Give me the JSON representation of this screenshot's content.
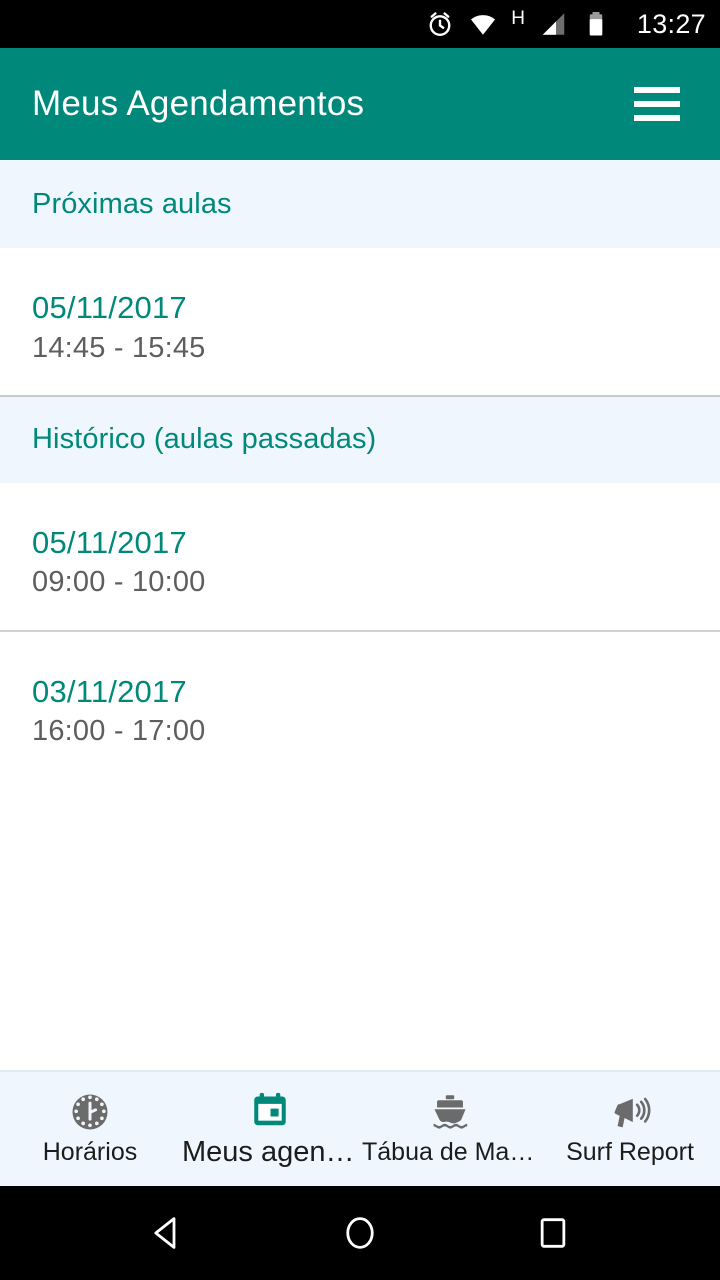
{
  "status_bar": {
    "time": "13:27",
    "network_type": "H",
    "icons": [
      "alarm-icon",
      "wifi-icon",
      "network-type-indicator",
      "signal-icon",
      "battery-icon"
    ]
  },
  "app_bar": {
    "title": "Meus Agendamentos",
    "menu_icon": "hamburger-menu-icon",
    "background_color": "#00897b"
  },
  "colors": {
    "accent_teal": "#00897b",
    "section_header_bg": "#eff6fd",
    "time_text": "#5e5e5e",
    "divider": "#d0d0d0"
  },
  "sections": [
    {
      "label": "Próximas aulas",
      "items": [
        {
          "date": "05/11/2017",
          "time": "14:45 - 15:45"
        }
      ]
    },
    {
      "label": "Histórico (aulas passadas)",
      "items": [
        {
          "date": "05/11/2017",
          "time": "09:00 - 10:00"
        },
        {
          "date": "03/11/2017",
          "time": "16:00 - 17:00"
        }
      ]
    }
  ],
  "bottom_nav": {
    "tabs": [
      {
        "label": "Horários",
        "icon": "clock-icon",
        "active": false
      },
      {
        "label": "Meus agenda…",
        "icon": "calendar-icon",
        "active": true
      },
      {
        "label": "Tábua de Marés",
        "icon": "boat-icon",
        "active": false
      },
      {
        "label": "Surf Report",
        "icon": "megaphone-icon",
        "active": false
      }
    ]
  },
  "system_nav": {
    "back_label": "back-button",
    "home_label": "home-button",
    "recents_label": "recents-button"
  }
}
